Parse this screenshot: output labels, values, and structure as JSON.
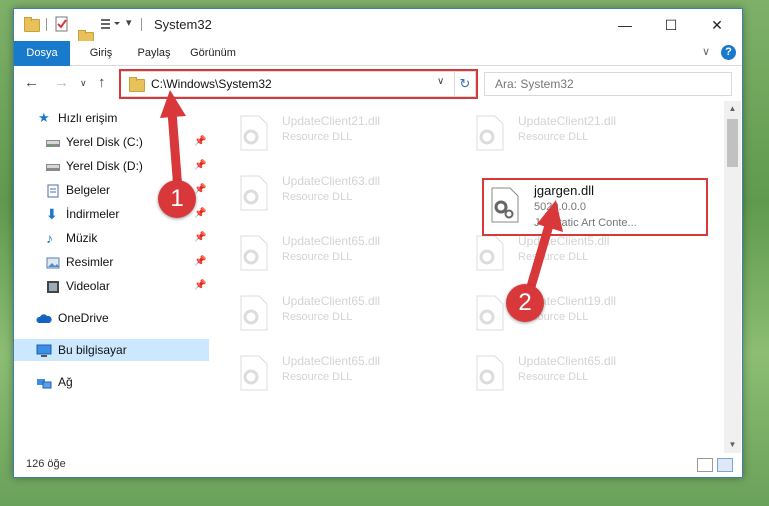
{
  "window": {
    "title": "System32",
    "minimize": "—",
    "maximize": "☐",
    "close": "✕"
  },
  "ribbon": {
    "tabs": [
      "Dosya",
      "Giriş",
      "Paylaş",
      "Görünüm"
    ],
    "help": "?"
  },
  "address": {
    "path": "C:\\Windows\\System32",
    "search_placeholder": "Ara: System32"
  },
  "nav": {
    "items": [
      {
        "label": "Hızlı erişim",
        "icon": "star-icon",
        "pinned": false
      },
      {
        "label": "Yerel Disk (C:)",
        "icon": "drive-icon",
        "pinned": true
      },
      {
        "label": "Yerel Disk (D:)",
        "icon": "drive-icon",
        "pinned": true
      },
      {
        "label": "Belgeler",
        "icon": "documents-icon",
        "pinned": true
      },
      {
        "label": "İndirmeler",
        "icon": "download-icon",
        "pinned": true
      },
      {
        "label": "Müzik",
        "icon": "music-icon",
        "pinned": true
      },
      {
        "label": "Resimler",
        "icon": "pictures-icon",
        "pinned": true
      },
      {
        "label": "Videolar",
        "icon": "video-icon",
        "pinned": true
      },
      {
        "label": "OneDrive",
        "icon": "cloud-icon",
        "pinned": false
      },
      {
        "label": "Bu bilgisayar",
        "icon": "computer-icon",
        "pinned": false,
        "selected": true
      },
      {
        "label": "Ağ",
        "icon": "network-icon",
        "pinned": false
      }
    ]
  },
  "files_left": [
    {
      "name": "UpdateClient21.dll",
      "type": "Resource DLL"
    },
    {
      "name": "UpdateClient63.dll",
      "type": "Resource DLL"
    },
    {
      "name": "UpdateClient65.dll",
      "type": "Resource DLL"
    },
    {
      "name": "UpdateClient65.dll",
      "type": "Resource DLL"
    },
    {
      "name": "UpdateClient65.dll",
      "type": "Resource DLL"
    }
  ],
  "files_right": [
    {
      "name": "UpdateClient21.dll",
      "type": "Resource DLL"
    },
    {
      "name": "UpdateClient5.dll",
      "type": "Resource DLL"
    },
    {
      "name": "UpdateClient19.dll",
      "type": "Resource DLL"
    },
    {
      "name": "UpdateClient65.dll",
      "type": "Resource DLL"
    }
  ],
  "highlighted_file": {
    "name": "jgargen.dll",
    "version": "5020.0.0.0",
    "description": "JG Static Art Conte..."
  },
  "status": {
    "count": "126 öğe"
  },
  "annotations": {
    "badge1": "1",
    "badge2": "2"
  },
  "colors": {
    "accent": "#1979ca",
    "highlight": "#d9383a"
  }
}
